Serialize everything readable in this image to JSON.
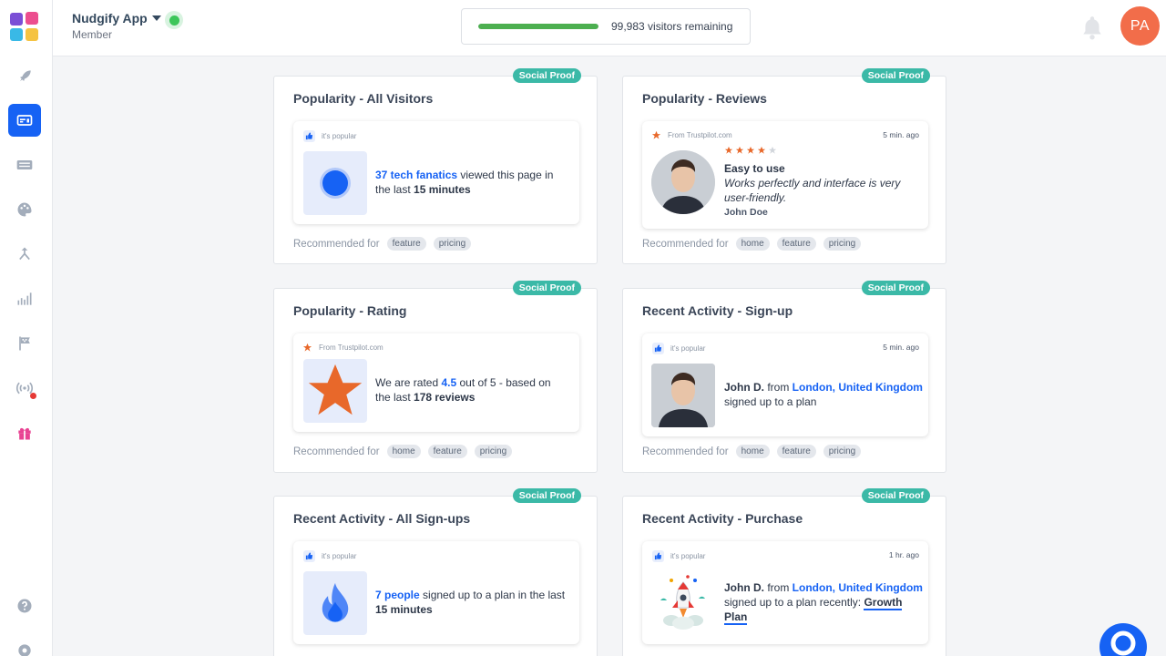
{
  "header": {
    "app_name": "Nudgify App",
    "role": "Member",
    "visitors_text": "99,983 visitors remaining",
    "visitors_progress_percent": 99.98,
    "avatar_initials": "PA"
  },
  "sidebar": {
    "items": [
      "rocket-icon",
      "notification-card-icon",
      "list-icon",
      "palette-icon",
      "merge-icon",
      "analytics-icon",
      "flag-icon",
      "broadcast-icon",
      "gift-icon",
      "help-icon",
      "settings-icon"
    ]
  },
  "cards": [
    {
      "badge": "Social Proof",
      "title": "Popularity - All Visitors",
      "head": "it's popular",
      "body_hl": "37 tech fanatics",
      "body_1": " viewed this page in the last ",
      "body_b": "15 minutes",
      "rec_label": "Recommended for",
      "tags": [
        "feature",
        "pricing"
      ]
    },
    {
      "badge": "Social Proof",
      "title": "Popularity - Reviews",
      "head": "From Trustpilot.com",
      "time": "5 min. ago",
      "rating_stars": 4,
      "review_title": "Easy to use",
      "review_text": "Works perfectly and interface is very user-friendly.",
      "reviewer": "John Doe",
      "rec_label": "Recommended for",
      "tags": [
        "home",
        "feature",
        "pricing"
      ]
    },
    {
      "badge": "Social Proof",
      "title": "Popularity - Rating",
      "head": "From Trustpilot.com",
      "body_1": "We are rated ",
      "body_hl": "4.5",
      "body_2": " out of 5 - based on the last ",
      "body_b": "178 reviews",
      "rec_label": "Recommended for",
      "tags": [
        "home",
        "feature",
        "pricing"
      ]
    },
    {
      "badge": "Social Proof",
      "title": "Recent Activity - Sign-up",
      "head": "it's popular",
      "time": "5 min. ago",
      "name": "John D.",
      "from": " from ",
      "location": "London, United Kingdom",
      "action": "signed up to a plan",
      "rec_label": "Recommended for",
      "tags": [
        "home",
        "feature",
        "pricing"
      ]
    },
    {
      "badge": "Social Proof",
      "title": "Recent Activity - All Sign-ups",
      "head": "it's popular",
      "body_hl": "7 people",
      "body_1": " signed up to a plan in the last ",
      "body_b": "15 minutes"
    },
    {
      "badge": "Social Proof",
      "title": "Recent Activity - Purchase",
      "head": "it's popular",
      "time": "1 hr. ago",
      "name": "John D.",
      "from": " from ",
      "location": "London, United Kingdom",
      "action": "signed up to a plan recently: ",
      "plan": "Growth Plan"
    }
  ],
  "colors": {
    "accent": "#1662f4",
    "badge": "#3bb9a7",
    "progress": "#4caf50",
    "avatar": "#f26d4a",
    "star": "#e8682a"
  }
}
